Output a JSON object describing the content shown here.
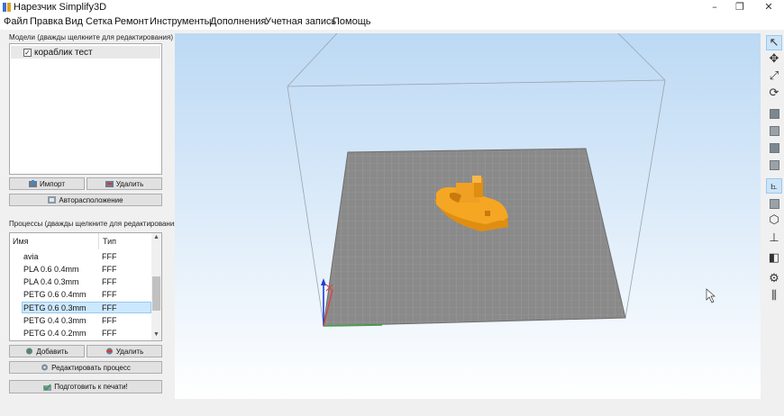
{
  "window": {
    "title": "Нарезчик Simplify3D",
    "minimize": "–",
    "restore": "❐",
    "close": "✕"
  },
  "menu": [
    "Файл",
    "Правка",
    "Вид",
    "Сетка",
    "Ремонт",
    "Инструменты",
    "Дополнения",
    "Учетная запись",
    "Помощь"
  ],
  "models": {
    "label": "Модели (дважды щелкните для редактирования)",
    "items": [
      {
        "name": "кораблик тест",
        "checked": true
      }
    ],
    "import_label": "Импорт",
    "delete_label": "Удалить",
    "autoplace_label": "Авторасположение"
  },
  "processes": {
    "label": "Процессы (дважды щелкните для редактирования)",
    "col_name": "Имя",
    "col_type": "Тип",
    "rows": [
      {
        "name": "avia",
        "type": "FFF"
      },
      {
        "name": "PLA 0.6 0.4mm",
        "type": "FFF"
      },
      {
        "name": "PLA 0.4 0.3mm",
        "type": "FFF"
      },
      {
        "name": "PETG 0.6 0.4mm",
        "type": "FFF"
      },
      {
        "name": "PETG 0.6 0.3mm",
        "type": "FFF",
        "selected": true
      },
      {
        "name": "PETG 0.4 0.3mm",
        "type": "FFF"
      },
      {
        "name": "PETG 0.4 0.2mm",
        "type": "FFF"
      }
    ],
    "scroll_up": "▲",
    "scroll_down": "▼",
    "add_label": "Добавить",
    "delete_label": "Удалить",
    "edit_label": "Редактировать процесс",
    "prepare_label": "Подготовить к печати!"
  },
  "viewport": {
    "background_top": "#bcd9f4",
    "background_bottom": "#ffffff",
    "bed_color": "#8a8a8a",
    "model_color": "#f5a623",
    "axis_x_color": "#e53935",
    "axis_y_color": "#43a047",
    "axis_z_color": "#1e3fd8"
  },
  "toolbar": {
    "items": [
      {
        "name": "select-pointer-icon",
        "glyph": "↖",
        "active": true
      },
      {
        "name": "move-icon",
        "glyph": "✥"
      },
      {
        "name": "scale-icon",
        "glyph": "⤢"
      },
      {
        "name": "rotate-icon",
        "glyph": "⟳"
      },
      {
        "name": "view-iso-icon",
        "glyph": "cube"
      },
      {
        "name": "view-front-icon",
        "glyph": "cube"
      },
      {
        "name": "view-top-icon",
        "glyph": "cube"
      },
      {
        "name": "view-side-icon",
        "glyph": "cube"
      },
      {
        "name": "axes-toggle-icon",
        "glyph": "⦜",
        "active": true
      },
      {
        "name": "solid-view-icon",
        "glyph": "cube"
      },
      {
        "name": "wireframe-view-icon",
        "glyph": "⬡"
      },
      {
        "name": "move-to-bed-icon",
        "glyph": "⊥"
      },
      {
        "name": "cross-section-icon",
        "glyph": "◧"
      },
      {
        "name": "settings-icon",
        "glyph": "⚙"
      },
      {
        "name": "supports-icon",
        "glyph": "⫼"
      }
    ]
  }
}
